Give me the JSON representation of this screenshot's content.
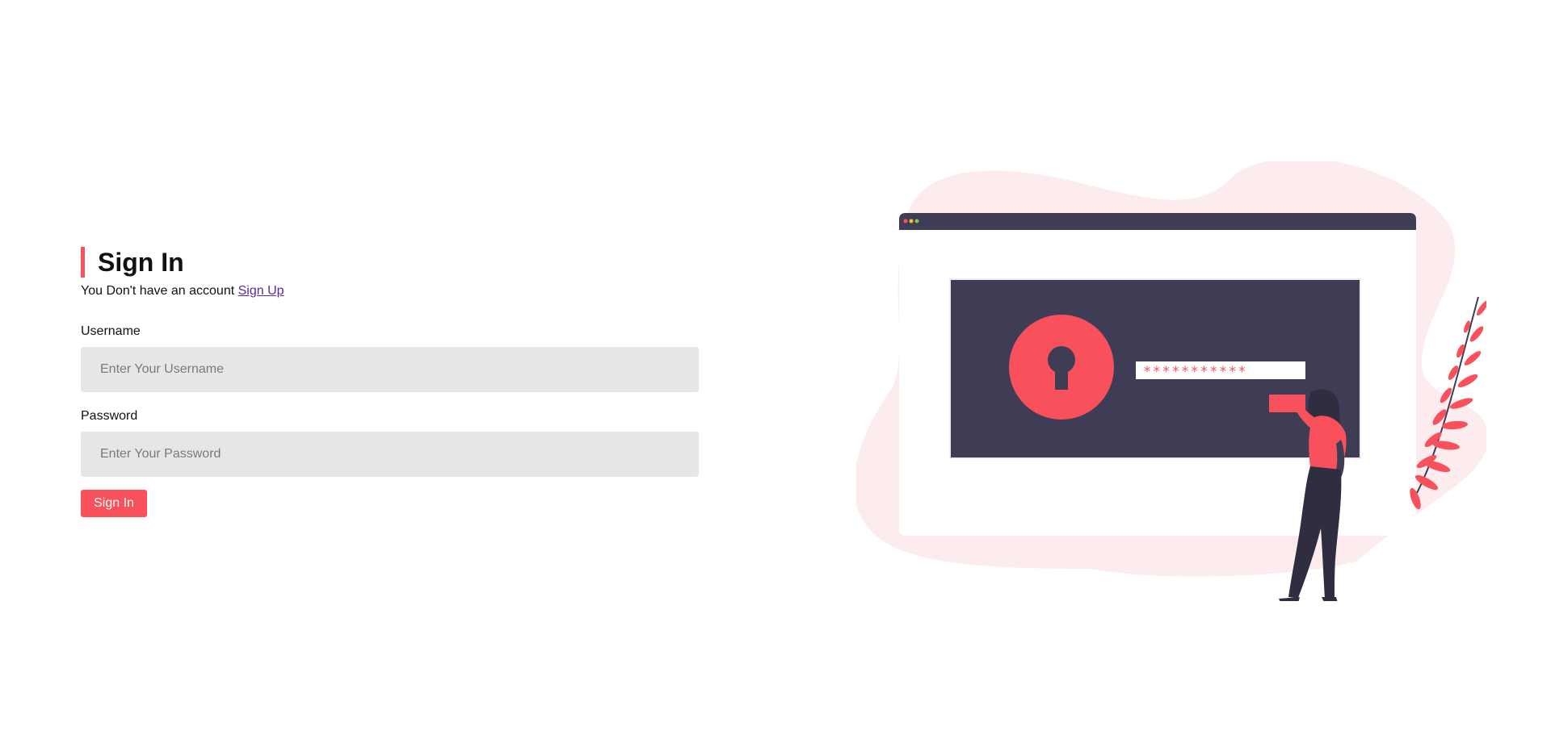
{
  "signin": {
    "title": "Sign In",
    "no_account_text": "You Don't have an account",
    "signup_link": "Sign Up",
    "username_label": "Username",
    "username_placeholder": "Enter Your Username",
    "username_value": "",
    "password_label": "Password",
    "password_placeholder": "Enter Your Password",
    "password_value": "",
    "submit_label": "Sign In"
  },
  "illustration": {
    "name": "secure-login-illustration",
    "password_mask": "***********"
  },
  "colors": {
    "accent": "#f9515c",
    "dark": "#3f3d56",
    "blob": "#fdecee",
    "input_bg": "#e6e6e6"
  }
}
